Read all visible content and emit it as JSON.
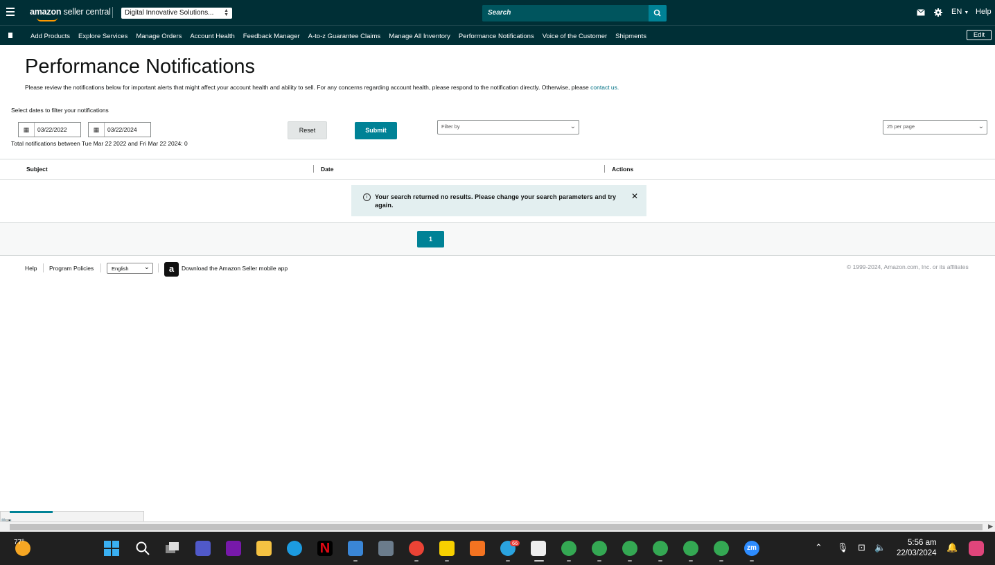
{
  "header": {
    "logo_text_bold": "amazon",
    "logo_text_rest": " seller central",
    "account_selector": "Digital Innovative Solutions...",
    "search_placeholder": "Search",
    "lang": "EN",
    "help": "Help"
  },
  "nav": {
    "items": [
      "Add Products",
      "Explore Services",
      "Manage Orders",
      "Account Health",
      "Feedback Manager",
      "A-to-z Guarantee Claims",
      "Manage All Inventory",
      "Performance Notifications",
      "Voice of the Customer",
      "Shipments"
    ],
    "edit": "Edit"
  },
  "page": {
    "title": "Performance Notifications",
    "description": "Please review the notifications below for important alerts that might affect your account health and ability to sell. For any concerns regarding account health, please respond to the notification directly. Otherwise, please",
    "contact_link": "contact us.",
    "date_filter_label": "Select dates to filter your notifications",
    "start_date": "03/22/2022",
    "end_date": "03/22/2024",
    "total_text": "Total notifications between Tue Mar 22 2022 and Fri Mar 22 2024: 0",
    "reset": "Reset",
    "submit": "Submit",
    "filter_placeholder": "Filter by",
    "per_page": "25 per page"
  },
  "table": {
    "columns": [
      "Subject",
      "Date",
      "Actions"
    ],
    "empty_message": "Your search returned no results. Please change your search parameters and try again."
  },
  "pagination": {
    "current_page": "1"
  },
  "footer": {
    "help": "Help",
    "program_policies": "Program Policies",
    "language": "English",
    "app_link": "Download the Amazon Seller mobile app",
    "copyright": "© 1999-2024, Amazon.com, Inc. or its affiliates"
  },
  "taskbar": {
    "weather_temp": "77°",
    "time": "5:56 am",
    "date": "22/03/2024",
    "telegram_badge": "66"
  },
  "colors": {
    "header_bg": "#002f36",
    "accent": "#008296",
    "alert_bg": "#e3eff0"
  }
}
